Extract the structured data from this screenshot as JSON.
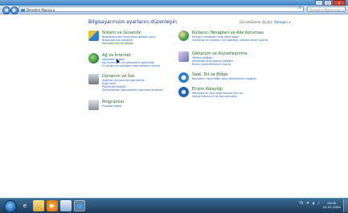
{
  "window": {
    "controls": {
      "minimize": "–",
      "maximize": "□",
      "close": "x"
    }
  },
  "navbar": {
    "back": "◀",
    "forward": "▶",
    "breadcrumb": "Denetim Masası ▸",
    "refresh": "⟳",
    "search_placeholder": "Denetim Masasında Ara",
    "search_icon": "magnifier-icon"
  },
  "main": {
    "heading": "Bilgisayarınızın ayarlarını düzenleyin",
    "view_by_label": "Görüntüleme ölçütü:",
    "view_by_value": "Kategori ▾"
  },
  "categories": [
    {
      "title": "Sistem ve Güvenlik",
      "links": [
        "Bilgisayarınızın durumunu gözden geçir",
        "Bilgisayarınızı yedekle",
        "Sorunları bul ve düzelt"
      ],
      "icon": "shield-flag-icon",
      "color": "#2e7fd0"
    },
    {
      "title": "Ağ ve İnternet",
      "links": [
        "İnternete bağlan",
        "Ağ durumunu ve görevlerini görüntüle",
        "Ev grubu ve paylaşım seçeneklerini belirle"
      ],
      "icon": "network-globe-icon",
      "color": "#2b8d3a"
    },
    {
      "title": "Donanım ve Ses",
      "links": [
        "Aygıtları ve yazıcıları görüntüle",
        "Aygıt ekle",
        "Projektöre bağlan",
        "Sık kullanılan taşınabilirlik ayarlarını düzenle"
      ],
      "icon": "printer-speaker-icon",
      "color": "#6d7a88"
    },
    {
      "title": "Programlar",
      "links": [
        "Program kaldır"
      ],
      "icon": "programs-icon",
      "color": "#8a8f99"
    },
    {
      "title": "Kullanıcı Hesapları ve Aile Koruması",
      "links": [
        "Kullanıcı hesapları ekle veya kaldır",
        "Herhangi bir kullanıcı için ebeveyn denetimlerini ayarla"
      ],
      "icon": "users-icon",
      "color": "#3d9a4a"
    },
    {
      "title": "Görünüm ve Kişiselleştirme",
      "links": [
        "Temayı değiştir",
        "Masaüstü arka planını değiştir",
        "Ekran çözünürlüğünü ayarla"
      ],
      "icon": "personalize-icon",
      "color": "#5a7dc8"
    },
    {
      "title": "Saat, Dil ve Bölge",
      "links": [
        "Klavyeleri veya diğer giriş yöntemlerini değiştir"
      ],
      "icon": "clock-globe-icon",
      "color": "#2f7fc9"
    },
    {
      "title": "Erişim Kolaylığı",
      "links": [
        "Windows'un ayar önermesine izin ver",
        "Görsel ekranı en iyi duruma getir"
      ],
      "icon": "accessibility-icon",
      "color": "#2463b8"
    }
  ],
  "taskbar": {
    "items": [
      "internet-explorer-icon",
      "folder-icon",
      "media-player-icon",
      "store-icon",
      "control-panel-icon"
    ],
    "tray_lang": "TR",
    "clock_time": "00:00",
    "clock_date": "01.01.2000"
  }
}
